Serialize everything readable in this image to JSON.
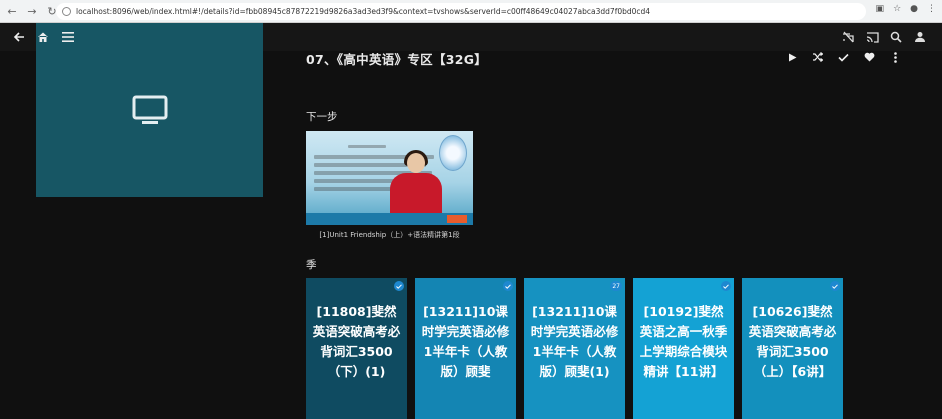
{
  "browser": {
    "url": "localhost:8096/web/index.html#!/details?id=fbb08945c87872219d9826a3ad3ed3f9&context=tvshows&serverId=c00ff48649c04027abca3dd7f0bd0cd4"
  },
  "header": {
    "back_icon": "arrow-left-icon",
    "home_icon": "home-icon",
    "menu_icon": "menu-icon",
    "right_icons": [
      "cast-off-icon",
      "cast-icon",
      "search-icon",
      "user-icon"
    ]
  },
  "title": "07、《高中英语》专区【32G】",
  "actions": [
    "play-icon",
    "shuffle-icon",
    "check-icon",
    "heart-icon",
    "more-icon"
  ],
  "next_up": {
    "label": "下一步",
    "caption": "[1]Unit1 Friendship（上）+语法精讲第1段"
  },
  "seasons": {
    "label": "季",
    "items": [
      {
        "text": "[11808]斐然英语突破高考必背词汇3500（下）(1)",
        "color": "#0f4b61",
        "badge": "check"
      },
      {
        "text": "[13211]10课时学完英语必修1半年卡（人教版）顾斐",
        "color": "#1485b3",
        "badge": "check"
      },
      {
        "text": "[13211]10课时学完英语必修1半年卡（人教版）顾斐(1)",
        "color": "#1692c1",
        "badge": "27"
      },
      {
        "text": "[10192]斐然英语之高一秋季上学期综合模块精讲【11讲】",
        "color": "#14a2d4",
        "badge": "check"
      },
      {
        "text": "[10626]斐然英语突破高考必背词汇3500（上）【6讲】",
        "color": "#1390bd",
        "badge": "check"
      }
    ]
  },
  "colors": {
    "poster": "#175664",
    "background": "#101010",
    "accent": "#1e88d0"
  }
}
